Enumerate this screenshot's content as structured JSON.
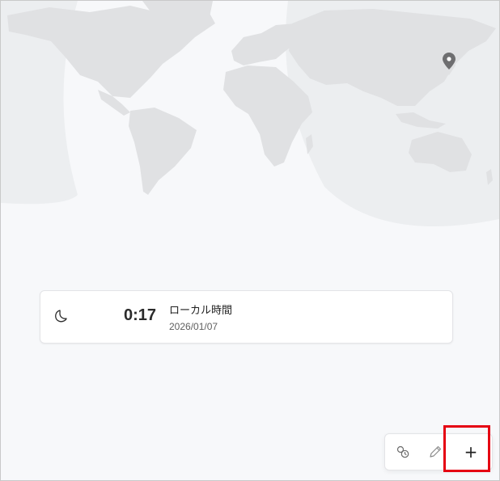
{
  "world_map": {
    "location_pin": "location-pin-icon"
  },
  "clock_card": {
    "icon": "moon-icon",
    "time": "0:17",
    "label": "ローカル時間",
    "date": "2026/01/07"
  },
  "toolbar": {
    "compare_icon": "compare-icon",
    "edit_icon": "pencil-icon",
    "add_label": "+"
  },
  "colors": {
    "land": "#e1e2e4",
    "night_shade": "#ebecee",
    "highlight": "#e50012"
  }
}
